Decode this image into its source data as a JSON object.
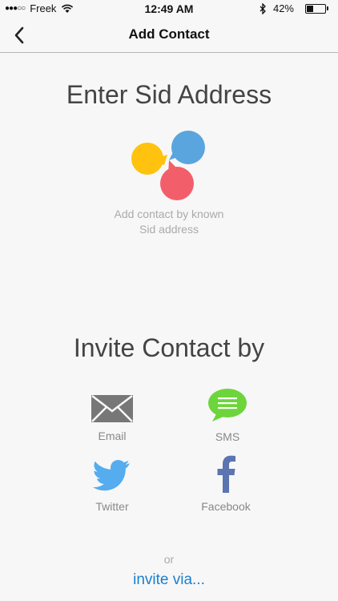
{
  "status_bar": {
    "signal": "●●●○○",
    "carrier": "Freek",
    "time": "12:49 AM",
    "battery_percent": "42%",
    "battery_level": 0.42,
    "icons": [
      "wifi-icon",
      "bluetooth-icon",
      "battery-icon"
    ]
  },
  "nav": {
    "title": "Add Contact",
    "back_icon": "chevron-left-icon"
  },
  "sid_section": {
    "title": "Enter Sid Address",
    "caption_line1": "Add contact by known",
    "caption_line2": "Sid address",
    "logo_colors": [
      "#ffc20e",
      "#5aa5dd",
      "#f25f6b"
    ]
  },
  "invite_section": {
    "title": "Invite Contact by",
    "options": [
      {
        "label": "Email",
        "icon": "mail-icon"
      },
      {
        "label": "SMS",
        "icon": "sms-icon",
        "color": "#6cd53b"
      },
      {
        "label": "Twitter",
        "icon": "twitter-icon",
        "color": "#55acee"
      },
      {
        "label": "Facebook",
        "icon": "facebook-icon",
        "color": "#5b74b2"
      }
    ],
    "or_text": "or",
    "invite_via": "invite via..."
  }
}
